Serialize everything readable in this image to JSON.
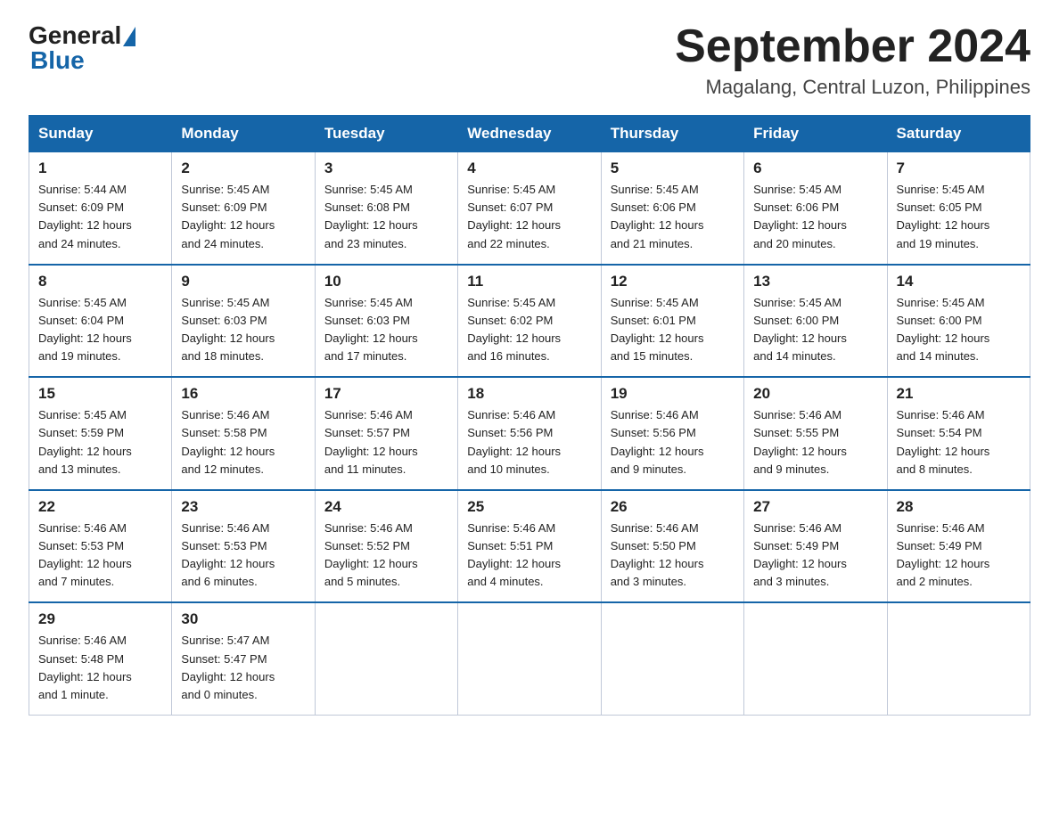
{
  "logo": {
    "general": "General",
    "blue": "Blue"
  },
  "header": {
    "month_year": "September 2024",
    "location": "Magalang, Central Luzon, Philippines"
  },
  "days_of_week": [
    "Sunday",
    "Monday",
    "Tuesday",
    "Wednesday",
    "Thursday",
    "Friday",
    "Saturday"
  ],
  "weeks": [
    [
      {
        "day": "1",
        "sunrise": "5:44 AM",
        "sunset": "6:09 PM",
        "daylight": "12 hours and 24 minutes."
      },
      {
        "day": "2",
        "sunrise": "5:45 AM",
        "sunset": "6:09 PM",
        "daylight": "12 hours and 24 minutes."
      },
      {
        "day": "3",
        "sunrise": "5:45 AM",
        "sunset": "6:08 PM",
        "daylight": "12 hours and 23 minutes."
      },
      {
        "day": "4",
        "sunrise": "5:45 AM",
        "sunset": "6:07 PM",
        "daylight": "12 hours and 22 minutes."
      },
      {
        "day": "5",
        "sunrise": "5:45 AM",
        "sunset": "6:06 PM",
        "daylight": "12 hours and 21 minutes."
      },
      {
        "day": "6",
        "sunrise": "5:45 AM",
        "sunset": "6:06 PM",
        "daylight": "12 hours and 20 minutes."
      },
      {
        "day": "7",
        "sunrise": "5:45 AM",
        "sunset": "6:05 PM",
        "daylight": "12 hours and 19 minutes."
      }
    ],
    [
      {
        "day": "8",
        "sunrise": "5:45 AM",
        "sunset": "6:04 PM",
        "daylight": "12 hours and 19 minutes."
      },
      {
        "day": "9",
        "sunrise": "5:45 AM",
        "sunset": "6:03 PM",
        "daylight": "12 hours and 18 minutes."
      },
      {
        "day": "10",
        "sunrise": "5:45 AM",
        "sunset": "6:03 PM",
        "daylight": "12 hours and 17 minutes."
      },
      {
        "day": "11",
        "sunrise": "5:45 AM",
        "sunset": "6:02 PM",
        "daylight": "12 hours and 16 minutes."
      },
      {
        "day": "12",
        "sunrise": "5:45 AM",
        "sunset": "6:01 PM",
        "daylight": "12 hours and 15 minutes."
      },
      {
        "day": "13",
        "sunrise": "5:45 AM",
        "sunset": "6:00 PM",
        "daylight": "12 hours and 14 minutes."
      },
      {
        "day": "14",
        "sunrise": "5:45 AM",
        "sunset": "6:00 PM",
        "daylight": "12 hours and 14 minutes."
      }
    ],
    [
      {
        "day": "15",
        "sunrise": "5:45 AM",
        "sunset": "5:59 PM",
        "daylight": "12 hours and 13 minutes."
      },
      {
        "day": "16",
        "sunrise": "5:46 AM",
        "sunset": "5:58 PM",
        "daylight": "12 hours and 12 minutes."
      },
      {
        "day": "17",
        "sunrise": "5:46 AM",
        "sunset": "5:57 PM",
        "daylight": "12 hours and 11 minutes."
      },
      {
        "day": "18",
        "sunrise": "5:46 AM",
        "sunset": "5:56 PM",
        "daylight": "12 hours and 10 minutes."
      },
      {
        "day": "19",
        "sunrise": "5:46 AM",
        "sunset": "5:56 PM",
        "daylight": "12 hours and 9 minutes."
      },
      {
        "day": "20",
        "sunrise": "5:46 AM",
        "sunset": "5:55 PM",
        "daylight": "12 hours and 9 minutes."
      },
      {
        "day": "21",
        "sunrise": "5:46 AM",
        "sunset": "5:54 PM",
        "daylight": "12 hours and 8 minutes."
      }
    ],
    [
      {
        "day": "22",
        "sunrise": "5:46 AM",
        "sunset": "5:53 PM",
        "daylight": "12 hours and 7 minutes."
      },
      {
        "day": "23",
        "sunrise": "5:46 AM",
        "sunset": "5:53 PM",
        "daylight": "12 hours and 6 minutes."
      },
      {
        "day": "24",
        "sunrise": "5:46 AM",
        "sunset": "5:52 PM",
        "daylight": "12 hours and 5 minutes."
      },
      {
        "day": "25",
        "sunrise": "5:46 AM",
        "sunset": "5:51 PM",
        "daylight": "12 hours and 4 minutes."
      },
      {
        "day": "26",
        "sunrise": "5:46 AM",
        "sunset": "5:50 PM",
        "daylight": "12 hours and 3 minutes."
      },
      {
        "day": "27",
        "sunrise": "5:46 AM",
        "sunset": "5:49 PM",
        "daylight": "12 hours and 3 minutes."
      },
      {
        "day": "28",
        "sunrise": "5:46 AM",
        "sunset": "5:49 PM",
        "daylight": "12 hours and 2 minutes."
      }
    ],
    [
      {
        "day": "29",
        "sunrise": "5:46 AM",
        "sunset": "5:48 PM",
        "daylight": "12 hours and 1 minute."
      },
      {
        "day": "30",
        "sunrise": "5:47 AM",
        "sunset": "5:47 PM",
        "daylight": "12 hours and 0 minutes."
      },
      null,
      null,
      null,
      null,
      null
    ]
  ],
  "labels": {
    "sunrise": "Sunrise:",
    "sunset": "Sunset:",
    "daylight": "Daylight:"
  }
}
